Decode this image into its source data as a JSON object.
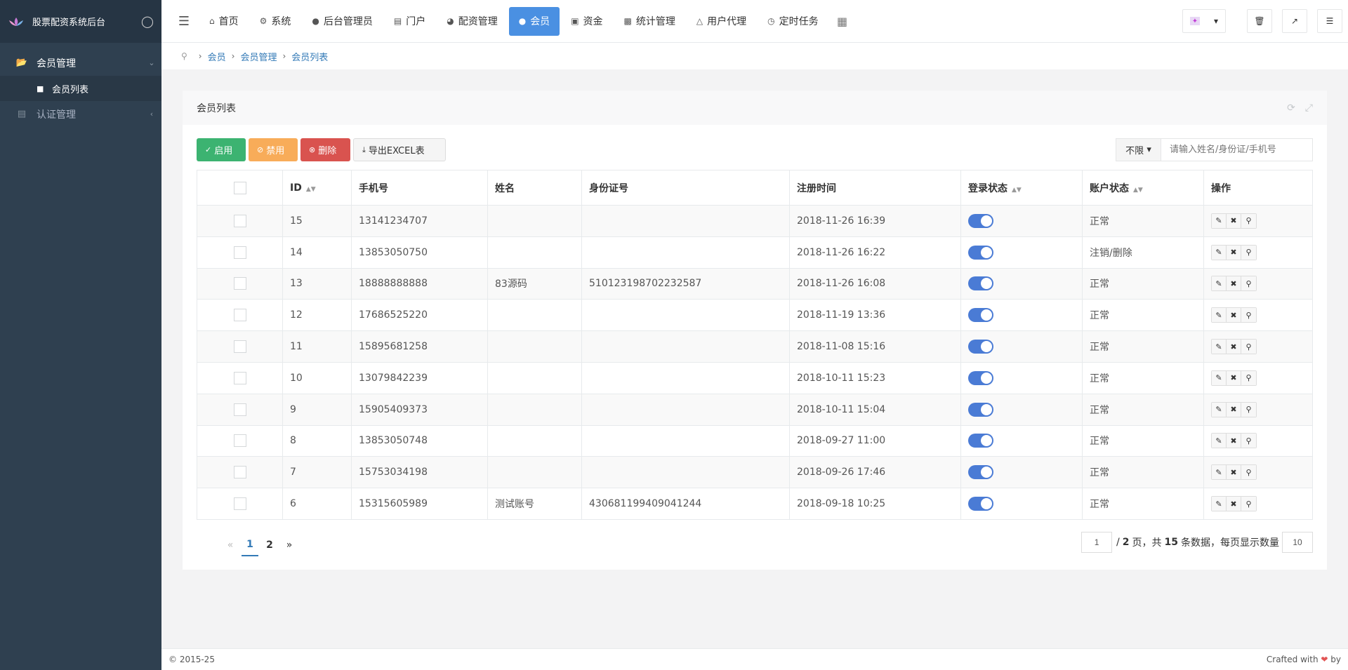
{
  "brand": {
    "title": "股票配资系统后台",
    "logo_icon": "lotus-logo",
    "drop_icon": "water-drop-icon"
  },
  "sidebar": {
    "items": [
      {
        "label": "会员管理",
        "icon": "folder-open-icon"
      },
      {
        "label": "会员列表",
        "icon": "user-icon"
      },
      {
        "label": "认证管理",
        "icon": "id-card-icon"
      }
    ]
  },
  "topnav": {
    "tabs": [
      {
        "label": "首页",
        "icon": "home-icon"
      },
      {
        "label": "系统",
        "icon": "gear-icon"
      },
      {
        "label": "后台管理员",
        "icon": "user-icon"
      },
      {
        "label": "门户",
        "icon": "newspaper-icon"
      },
      {
        "label": "配资管理",
        "icon": "pie-chart-icon"
      },
      {
        "label": "会员",
        "icon": "users-icon"
      },
      {
        "label": "资金",
        "icon": "money-icon"
      },
      {
        "label": "统计管理",
        "icon": "bar-chart-icon"
      },
      {
        "label": "用户代理",
        "icon": "sitemap-icon"
      },
      {
        "label": "定时任务",
        "icon": "clock-icon"
      }
    ],
    "active_tab": "会员"
  },
  "breadcrumb": [
    "会员",
    "会员管理",
    "会员列表"
  ],
  "panel": {
    "title": "会员列表"
  },
  "toolbar": {
    "enable": "启用",
    "disable": "禁用",
    "delete": "删除",
    "export": "导出EXCEL表"
  },
  "search": {
    "select": "不限",
    "placeholder": "请输入姓名/身份证/手机号"
  },
  "table": {
    "columns": [
      "ID",
      "手机号",
      "姓名",
      "身份证号",
      "注册时间",
      "登录状态",
      "账户状态",
      "操作"
    ],
    "rows": [
      {
        "id": "15",
        "phone": "13141234707",
        "name": "",
        "idcard": "",
        "time": "2018-11-26 16:39",
        "login": true,
        "status": "正常"
      },
      {
        "id": "14",
        "phone": "13853050750",
        "name": "",
        "idcard": "",
        "time": "2018-11-26 16:22",
        "login": true,
        "status": "注销/删除"
      },
      {
        "id": "13",
        "phone": "18888888888",
        "name": "83源码",
        "idcard": "510123198702232587",
        "time": "2018-11-26 16:08",
        "login": true,
        "status": "正常"
      },
      {
        "id": "12",
        "phone": "17686525220",
        "name": "",
        "idcard": "",
        "time": "2018-11-19 13:36",
        "login": true,
        "status": "正常"
      },
      {
        "id": "11",
        "phone": "15895681258",
        "name": "",
        "idcard": "",
        "time": "2018-11-08 15:16",
        "login": true,
        "status": "正常"
      },
      {
        "id": "10",
        "phone": "13079842239",
        "name": "",
        "idcard": "",
        "time": "2018-10-11 15:23",
        "login": true,
        "status": "正常"
      },
      {
        "id": "9",
        "phone": "15905409373",
        "name": "",
        "idcard": "",
        "time": "2018-10-11 15:04",
        "login": true,
        "status": "正常"
      },
      {
        "id": "8",
        "phone": "13853050748",
        "name": "",
        "idcard": "",
        "time": "2018-09-27 11:00",
        "login": true,
        "status": "正常"
      },
      {
        "id": "7",
        "phone": "15753034198",
        "name": "",
        "idcard": "",
        "time": "2018-09-26 17:46",
        "login": true,
        "status": "正常"
      },
      {
        "id": "6",
        "phone": "15315605989",
        "name": "测试账号",
        "idcard": "430681199409041244",
        "time": "2018-09-18 10:25",
        "login": true,
        "status": "正常"
      }
    ]
  },
  "pagination": {
    "prev": "«",
    "pages": [
      "1",
      "2"
    ],
    "next": "»",
    "current": "1",
    "input_page": "1",
    "total_pages": "2",
    "total_records": "15",
    "page_size": "10",
    "text_pages_prefix": "/",
    "text_pages_mid": "页，共",
    "text_records_suffix": "条数据，每页显示数量"
  },
  "footer": {
    "left": "© 2015-25",
    "right_prefix": "Crafted with",
    "right_suffix": "by"
  },
  "colors": {
    "sidebar": "#2f4050",
    "active_tab": "#4a90e2",
    "toggle": "#4a7bd5",
    "link": "#337ab7"
  }
}
